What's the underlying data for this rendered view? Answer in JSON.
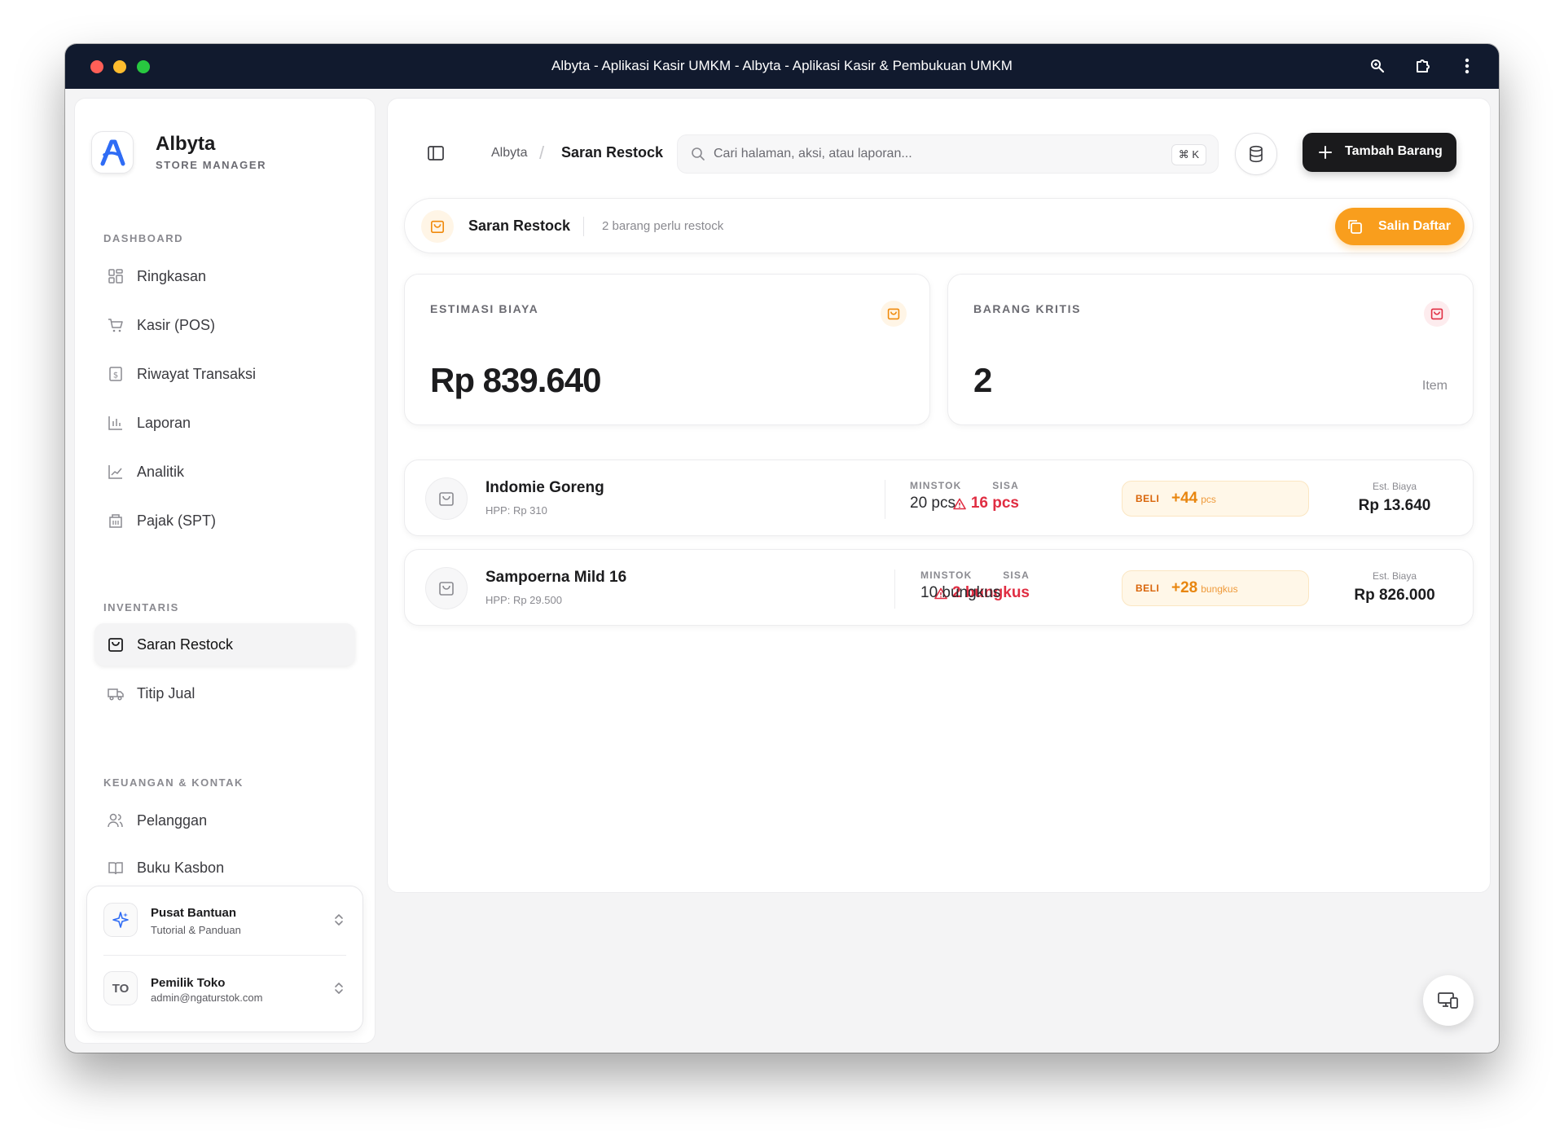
{
  "window": {
    "title": "Albyta - Aplikasi Kasir UMKM - Albyta - Aplikasi Kasir & Pembukuan UMKM"
  },
  "brand": {
    "name": "Albyta",
    "subtitle": "STORE MANAGER",
    "accent": "#2f6cf5"
  },
  "sidebar": {
    "sections": [
      {
        "label": "DASHBOARD"
      },
      {
        "label": "INVENTARIS"
      },
      {
        "label": "KEUANGAN & KONTAK"
      }
    ],
    "items": [
      {
        "label": "Ringkasan",
        "icon": "grid-icon"
      },
      {
        "label": "Kasir (POS)",
        "icon": "cart-icon"
      },
      {
        "label": "Riwayat Transaksi",
        "icon": "receipt-icon"
      },
      {
        "label": "Laporan",
        "icon": "bar-chart-icon"
      },
      {
        "label": "Analitik",
        "icon": "line-chart-icon"
      },
      {
        "label": "Pajak (SPT)",
        "icon": "building-icon"
      },
      {
        "label": "Saran Restock",
        "icon": "bag-icon",
        "active": true
      },
      {
        "label": "Titip Jual",
        "icon": "truck-icon"
      },
      {
        "label": "Pelanggan",
        "icon": "users-icon"
      },
      {
        "label": "Buku Kasbon",
        "icon": "book-icon"
      }
    ],
    "help": {
      "title": "Pusat Bantuan",
      "subtitle": "Tutorial & Panduan"
    },
    "user": {
      "initials": "TO",
      "name": "Pemilik Toko",
      "email": "admin@ngaturstok.com"
    }
  },
  "topbar": {
    "breadcrumb_root": "Albyta",
    "breadcrumb_sep": "/",
    "breadcrumb_current": "Saran Restock",
    "search_placeholder": "Cari halaman, aksi, atau laporan...",
    "search_shortcut": "⌘ K",
    "add_button": "Tambah Barang"
  },
  "header": {
    "title": "Saran Restock",
    "subtitle": "2 barang perlu restock",
    "copy_button": "Salin Daftar",
    "accent": "#f99e1d"
  },
  "stats": [
    {
      "label": "ESTIMASI BIAYA",
      "value": "Rp 839.640",
      "unit": ""
    },
    {
      "label": "BARANG KRITIS",
      "value": "2",
      "unit": "Item"
    }
  ],
  "restock": {
    "columns": {
      "sisa": "SISA",
      "minstok": "MINSTOK",
      "beli": "BELI",
      "est": "Est. Biaya"
    },
    "items": [
      {
        "name": "Indomie Goreng",
        "hpp": "HPP: Rp 310",
        "sisa": "16 pcs",
        "minstok": "20 pcs",
        "beli_qty": "+44",
        "beli_unit": "pcs",
        "est": "Rp 13.640"
      },
      {
        "name": "Sampoerna Mild 16",
        "hpp": "HPP: Rp 29.500",
        "sisa": "2 bungkus",
        "minstok": "10 bungkus",
        "beli_qty": "+28",
        "beli_unit": "bungkus",
        "est": "Rp 826.000"
      }
    ]
  },
  "colors": {
    "danger": "#e02d42",
    "dark": "#1a1a1c",
    "titlebar": "#111a2e"
  }
}
